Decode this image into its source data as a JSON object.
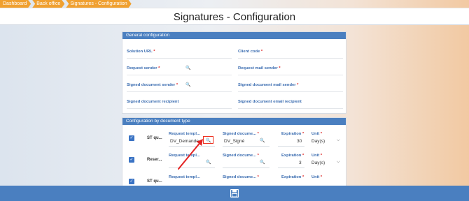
{
  "breadcrumb": [
    "Dashboard",
    "Back office",
    "Signatures - Configuration"
  ],
  "page_title": "Signatures - Configuration",
  "general": {
    "header": "General configuration",
    "fields": [
      {
        "label": "Solution URL",
        "required": "*",
        "search": false
      },
      {
        "label": "Client code",
        "required": "*",
        "search": false
      },
      {
        "label": "Request sender",
        "required": "*",
        "search": true
      },
      {
        "label": "Request mail sender",
        "required": "*",
        "search": false
      },
      {
        "label": "Signed document sender",
        "required": "*",
        "search": true
      },
      {
        "label": "Signed document mail sender",
        "required": "*",
        "search": false
      },
      {
        "label": "Signed document recipient",
        "required": "",
        "search": false
      },
      {
        "label": "Signed document email recipient",
        "required": "",
        "search": false
      }
    ]
  },
  "bydoc": {
    "header": "Configuration by document type",
    "col_labels": {
      "request_template": "Request templ...",
      "signed_document": "Signed docume...",
      "expiration": "Expiration",
      "unit": "Unit"
    },
    "required": "*",
    "rows": [
      {
        "doctype": "ST qu...",
        "request_template": "DV_Demande",
        "signed_document": "DV_Signé",
        "expiration": "30",
        "unit": "Day(s)",
        "checked": "✓"
      },
      {
        "doctype": "Reser...",
        "request_template": "",
        "signed_document": "",
        "expiration": "3",
        "unit": "Day(s)",
        "checked": "✓"
      },
      {
        "doctype": "ST qu...",
        "request_template": "",
        "signed_document": "",
        "expiration": "",
        "unit": "",
        "checked": "✓"
      }
    ]
  },
  "icons": {
    "search": "search-icon",
    "chevron": "chevron-down-icon",
    "save": "save-icon",
    "check": "check-icon"
  },
  "colors": {
    "accent": "#4a7fc0",
    "breadcrumb": "#f0a030",
    "required": "#dd2222",
    "highlight": "#ee3322"
  }
}
